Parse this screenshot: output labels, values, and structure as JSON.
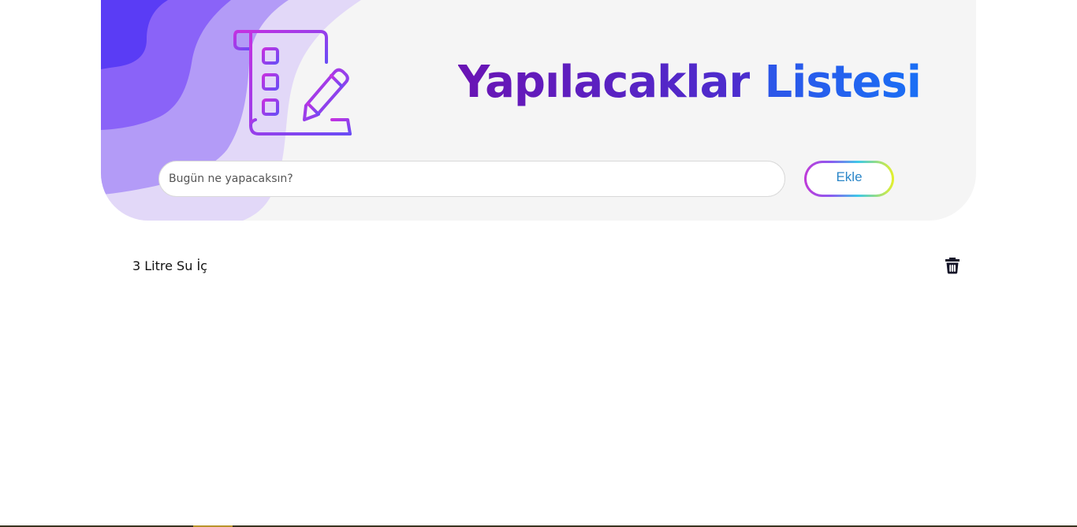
{
  "header": {
    "title_word1": "Yapılacaklar",
    "title_word2": "Listesi",
    "logo_icon": "checklist-pencil-icon"
  },
  "form": {
    "input_placeholder": "Bugün ne yapacaksın?",
    "input_value": "",
    "add_label": "Ekle"
  },
  "todos": [
    {
      "text": "3 Litre Su İç",
      "delete_icon": "trash-icon"
    }
  ],
  "colors": {
    "title_start": "#6a14b4",
    "title_end": "#1a6ff5",
    "wave_dark": "#5a3cf5",
    "wave_mid": "#8a63f8",
    "wave_light": "#b39bf7",
    "wave_lightest": "#e2d8f8",
    "card_bg": "#f5f5f5",
    "button_text": "#2a86c8"
  }
}
